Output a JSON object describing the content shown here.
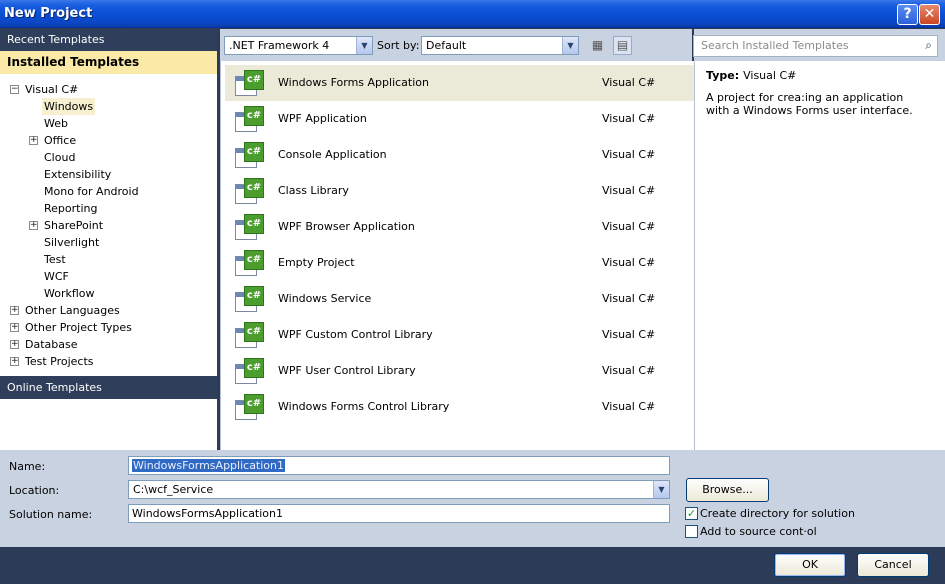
{
  "window": {
    "title": "New Project"
  },
  "left_panel": {
    "recent_templates": "Recent Templates",
    "installed_templates": "Installed Templates",
    "online_templates": "Online Templates",
    "tree": [
      {
        "label": "Visual C#",
        "expander": "−"
      },
      {
        "label": "Windows"
      },
      {
        "label": "Web"
      },
      {
        "label": "Office",
        "expander": "+"
      },
      {
        "label": "Cloud"
      },
      {
        "label": "Extensibility"
      },
      {
        "label": "Mono for Android"
      },
      {
        "label": "Reporting"
      },
      {
        "label": "SharePoint",
        "expander": "+"
      },
      {
        "label": "Silverlight"
      },
      {
        "label": "Test"
      },
      {
        "label": "WCF"
      },
      {
        "label": "Workflow"
      },
      {
        "label": "Other Languages",
        "expander": "+"
      },
      {
        "label": "Other Project Types",
        "expander": "+"
      },
      {
        "label": "Database",
        "expander": "+"
      },
      {
        "label": "Test Projects",
        "expander": "+"
      }
    ]
  },
  "toolbar": {
    "framework": ".NET Framework 4",
    "sort_label": "Sort by:",
    "sort_value": "Default",
    "search_placeholder": "Search Installed Templates"
  },
  "templates": [
    {
      "name": "Windows Forms Application",
      "lang": "Visual C#"
    },
    {
      "name": "WPF Application",
      "lang": "Visual C#"
    },
    {
      "name": "Console Application",
      "lang": "Visual C#"
    },
    {
      "name": "Class Library",
      "lang": "Visual C#"
    },
    {
      "name": "WPF Browser Application",
      "lang": "Visual C#"
    },
    {
      "name": "Empty Project",
      "lang": "Visual C#"
    },
    {
      "name": "Windows Service",
      "lang": "Visual C#"
    },
    {
      "name": "WPF Custom Control Library",
      "lang": "Visual C#"
    },
    {
      "name": "WPF User Control Library",
      "lang": "Visual C#"
    },
    {
      "name": "Windows Forms Control Library",
      "lang": "Visual C#"
    }
  ],
  "details": {
    "type_label": "Type:",
    "type_value": "Visual C#",
    "description": "A project for crea:ing an application with a Windows Forms user interface."
  },
  "form": {
    "name_label": "Name:",
    "name_value": "WindowsFormsApplication1",
    "location_label": "Location:",
    "location_value": "C:\\wcf_Service",
    "solution_label": "Solution name:",
    "solution_value": "WindowsFormsApplication1",
    "browse": "Browse...",
    "create_dir": "Create directory for solution",
    "source_control": "Add to source cont·ol"
  },
  "buttons": {
    "ok": "OK",
    "cancel": "Cancel"
  },
  "icons": {
    "help": "?",
    "close": "✕",
    "search": "⌕",
    "arrow": "▼",
    "check": "✓",
    "cs": "c#"
  }
}
